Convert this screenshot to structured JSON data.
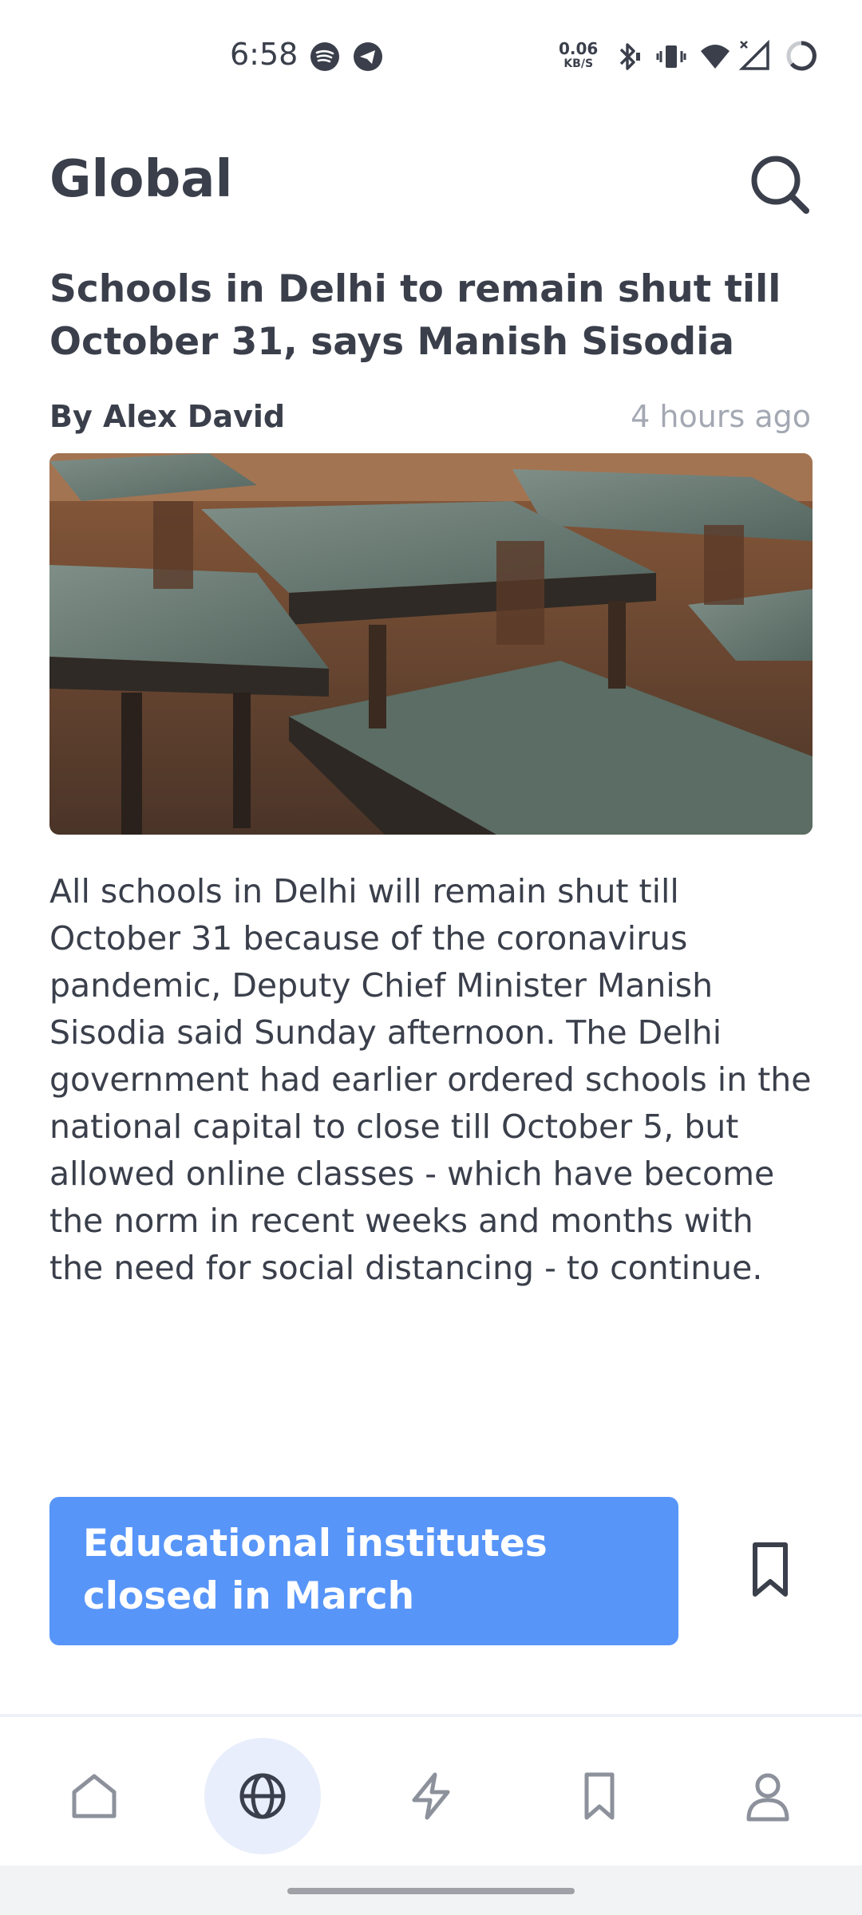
{
  "status_bar": {
    "time": "6:58",
    "net_speed_value": "0.06",
    "net_speed_unit": "KB/S",
    "icons": [
      "spotify-icon",
      "telegram-icon",
      "bluetooth-icon",
      "vibrate-icon",
      "wifi-icon",
      "cellular-signal-icon",
      "battery-icon"
    ]
  },
  "header": {
    "title": "Global",
    "search_icon": "search-icon"
  },
  "article": {
    "headline": "Schools in Delhi to remain shut till October 31, says Manish Sisodia",
    "byline": "By Alex David",
    "timestamp": "4 hours ago",
    "body": "All schools in Delhi will remain shut till October 31 because of the coronavirus pandemic, Deputy Chief Minister Manish Sisodia said Sunday afternoon. The Delhi government had earlier ordered schools in the national capital to close till October 5, but allowed online classes - which have become the norm in recent weeks and months with the need for social distancing - to continue."
  },
  "related": {
    "label": "Educational institutes closed in March",
    "bookmark_icon": "bookmark-icon"
  },
  "bottom_nav": {
    "items": [
      {
        "icon": "home-icon",
        "active": false
      },
      {
        "icon": "globe-icon",
        "active": true
      },
      {
        "icon": "lightning-icon",
        "active": false
      },
      {
        "icon": "bookmark-icon",
        "active": false
      },
      {
        "icon": "profile-icon",
        "active": false
      }
    ]
  },
  "colors": {
    "text": "#3a3f4b",
    "muted": "#a3a8b3",
    "accent": "#5795f8",
    "active_nav_bg": "#e8eefb"
  }
}
